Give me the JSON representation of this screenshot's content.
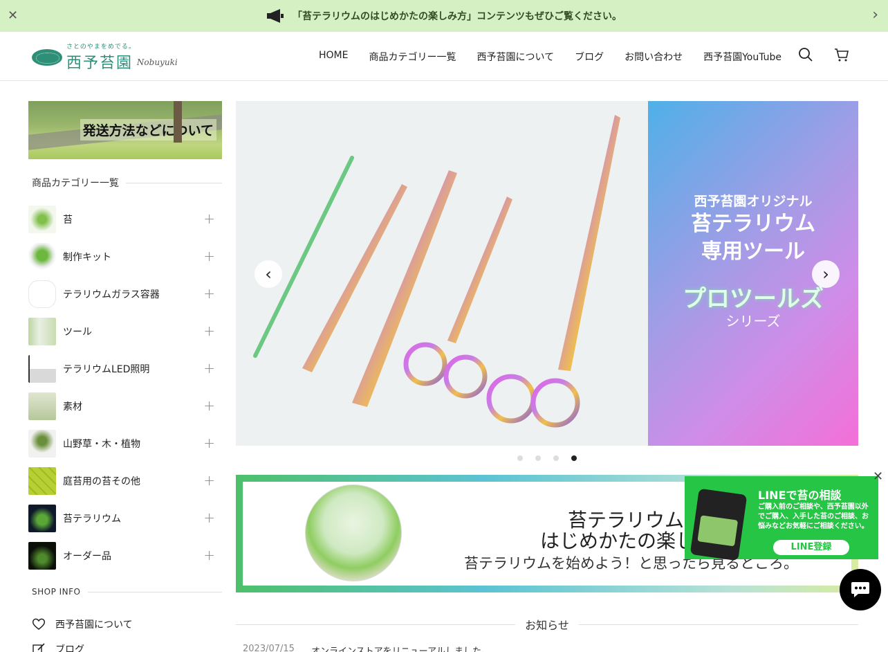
{
  "announcement": {
    "message": "「苔テラリウムのはじめかたの楽しみ方」コンテンツもぜひご覧ください。",
    "bg_color": "#d5f1c4"
  },
  "header": {
    "logo_tagline": "さとのやまをめでる。",
    "logo_name": "西予苔園",
    "logo_signature": "Nobuyuki",
    "nav": [
      "HOME",
      "商品カテゴリー一覧",
      "西予苔園について",
      "ブログ",
      "お問い合わせ",
      "西予苔園YouTube"
    ],
    "icons": [
      "search-icon",
      "cart-icon"
    ]
  },
  "sidebar": {
    "shipping_banner": "発送方法などについて",
    "categories_title": "商品カテゴリー一覧",
    "categories": [
      {
        "label": "苔"
      },
      {
        "label": "制作キット"
      },
      {
        "label": "テラリウムガラス容器"
      },
      {
        "label": "ツール"
      },
      {
        "label": "テラリウムLED照明"
      },
      {
        "label": "素材"
      },
      {
        "label": "山野草・木・植物"
      },
      {
        "label": "庭苔用の苔その他"
      },
      {
        "label": "苔テラリウム"
      },
      {
        "label": "オーダー品"
      }
    ],
    "shop_info_title": "SHOP INFO",
    "shop_links": [
      {
        "label": "西予苔園について",
        "icon": "heart-icon"
      },
      {
        "label": "ブログ",
        "icon": "edit-icon"
      }
    ]
  },
  "slider": {
    "promo_line1": "西予苔園オリジナル",
    "promo_line2": "苔テラリウム",
    "promo_line3": "専用ツール",
    "promo_line4": "プロツールズ",
    "promo_line5": "シリーズ",
    "dot_count": 4,
    "active_dot": 4
  },
  "terrarium_banner": {
    "line1": "苔テラリウムの",
    "line2": "はじめかたの楽し",
    "line3": "苔テラリウムを始めよう！と思ったら見るところ。"
  },
  "line_popup": {
    "title": "LINEで苔の相談",
    "desc": "ご購入前のご相談や、西予苔園以外でご購入、入手した苔のご相談、お悩みなどお気軽にご相談ください。",
    "button": "LINE登録",
    "color": "#27c546"
  },
  "news": {
    "title": "お知らせ",
    "items": [
      {
        "date": "2023/07/15",
        "text": "オンラインストアをリニューアルしました。"
      }
    ]
  }
}
